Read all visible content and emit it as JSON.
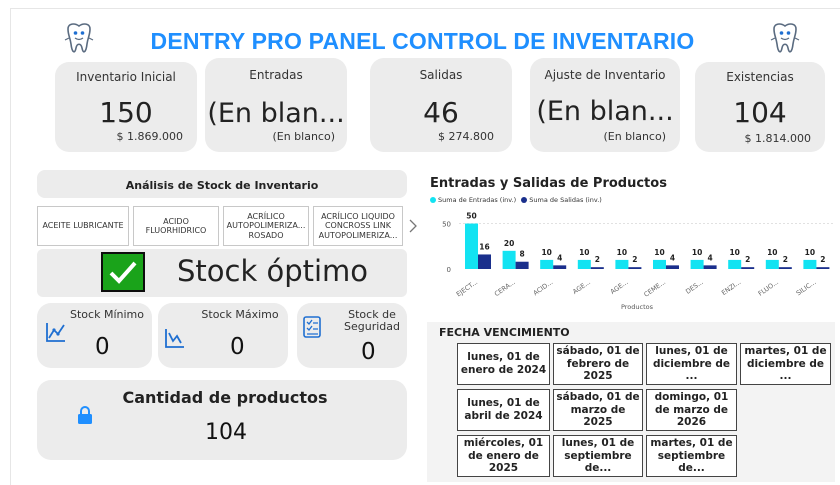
{
  "header": {
    "title": "DENTRY PRO PANEL CONTROL DE INVENTARIO"
  },
  "kpis": [
    {
      "label": "Inventario Inicial",
      "value": "150",
      "sub": "$ 1.869.000"
    },
    {
      "label": "Entradas",
      "value": "(En blan...",
      "sub": "(En blanco)"
    },
    {
      "label": "Salidas",
      "value": "46",
      "sub": "$ 274.800"
    },
    {
      "label": "Ajuste de Inventario",
      "value": "(En blan...",
      "sub": "(En blanco)"
    },
    {
      "label": "Existencias",
      "value": "104",
      "sub": "$ 1.814.000"
    }
  ],
  "stock_analysis": {
    "title": "Análisis de Stock de Inventario",
    "products": [
      "ACEITE LUBRICANTE",
      "ACIDO FLUORHIDRICO",
      "ACRÍLICO AUTOPOLIMERIZA... ROSADO",
      "ACRÍLICO LIQUIDO CONCROSS LINK AUTOPOLIMERIZA..."
    ],
    "status": "Stock óptimo",
    "status_color": "#1aa31a"
  },
  "metrics": [
    {
      "label": "Stock Mínimo",
      "value": "0",
      "icon": "line-chart-icon"
    },
    {
      "label": "Stock Máximo",
      "value": "0",
      "icon": "trend-chart-icon"
    },
    {
      "label": "Stock de Seguridad",
      "value": "0",
      "icon": "checklist-icon"
    }
  ],
  "quantity": {
    "label": "Cantidad de productos",
    "value": "104",
    "icon": "lock-icon"
  },
  "chart_data": {
    "type": "bar",
    "title": "Entradas y Salidas de Productos",
    "xlabel": "Productos",
    "ylabel": "",
    "ylim": [
      0,
      55
    ],
    "yticks": [
      "0",
      "50"
    ],
    "categories": [
      "EJECT...",
      "CERA...",
      "ACID...",
      "AGE...",
      "AGE...",
      "CEME...",
      "DES...",
      "ENZI...",
      "FLUO...",
      "SILIC..."
    ],
    "series": [
      {
        "name": "Suma de Entradas (inv.)",
        "color": "#12e3f2",
        "values": [
          50,
          20,
          10,
          10,
          10,
          10,
          10,
          10,
          10,
          10
        ]
      },
      {
        "name": "Suma de Salidas (inv.)",
        "color": "#1a2f8c",
        "values": [
          16,
          8,
          4,
          2,
          2,
          4,
          4,
          2,
          2,
          2
        ]
      }
    ]
  },
  "expiry": {
    "title": "FECHA VENCIMIENTO",
    "dates": [
      "lunes, 01 de enero de 2024",
      "sábado, 01 de febrero de 2025",
      "lunes, 01 de diciembre de ...",
      "martes, 01 de diciembre de ...",
      "lunes, 01 de abril de 2024",
      "sábado, 01 de marzo de 2025",
      "domingo, 01 de marzo de 2026",
      "miércoles, 01 de enero de 2025",
      "lunes, 01 de septiembre de...",
      "martes, 01 de septiembre de..."
    ]
  }
}
